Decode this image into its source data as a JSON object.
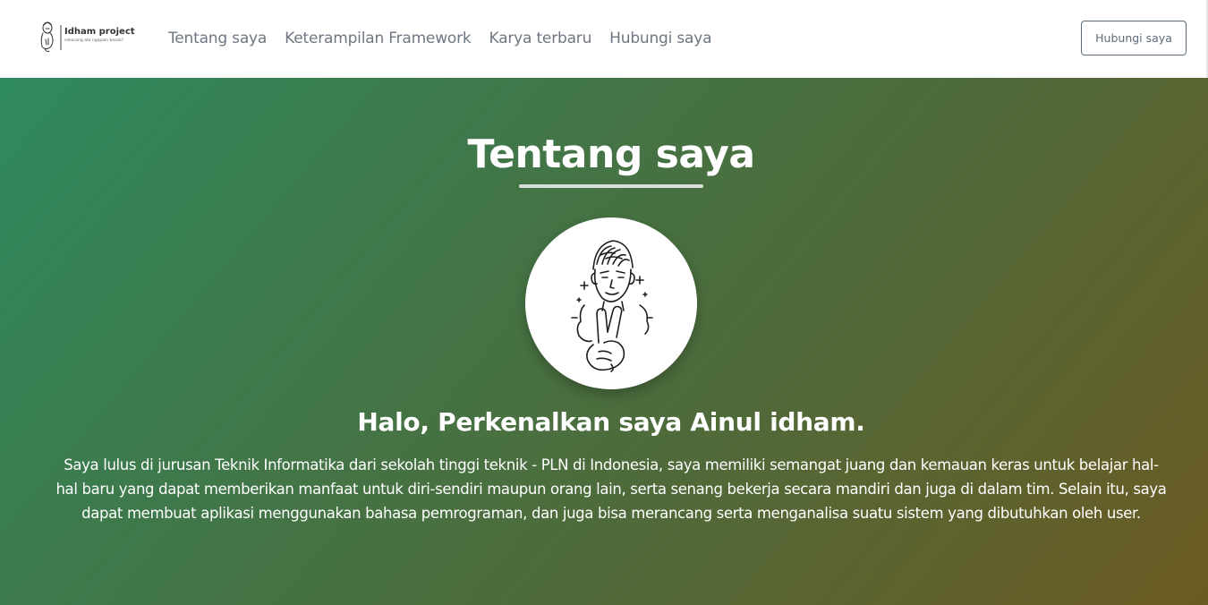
{
  "brand": {
    "name": "Idham project",
    "tagline": "sekarang ato ngapain besok?",
    "logo_icon": "person-sketch-icon"
  },
  "nav": {
    "items": [
      {
        "label": "Tentang saya"
      },
      {
        "label": "Keterampilan Framework"
      },
      {
        "label": "Karya terbaru"
      },
      {
        "label": "Hubungi saya"
      }
    ],
    "contact_button": "Hubungi saya"
  },
  "about": {
    "title": "Tentang saya",
    "avatar_icon": "peace-sign-portrait-icon",
    "greeting": "Halo, Perkenalkan saya Ainul idham.",
    "bio": "Saya lulus di jurusan Teknik Informatika dari sekolah tinggi teknik - PLN di Indonesia, saya memiliki semangat juang dan kemauan keras untuk belajar hal-hal baru yang dapat memberikan manfaat untuk diri-sendiri maupun orang lain, serta senang bekerja secara mandiri dan juga di dalam tim. Selain itu, saya dapat membuat aplikasi menggunakan bahasa pemrograman, dan juga bisa merancang serta menganalisa suatu sistem yang dibutuhkan oleh user."
  },
  "colors": {
    "gradient_start": "#2e8a5e",
    "gradient_end": "#6b5a22",
    "nav_text": "#6f7783"
  }
}
